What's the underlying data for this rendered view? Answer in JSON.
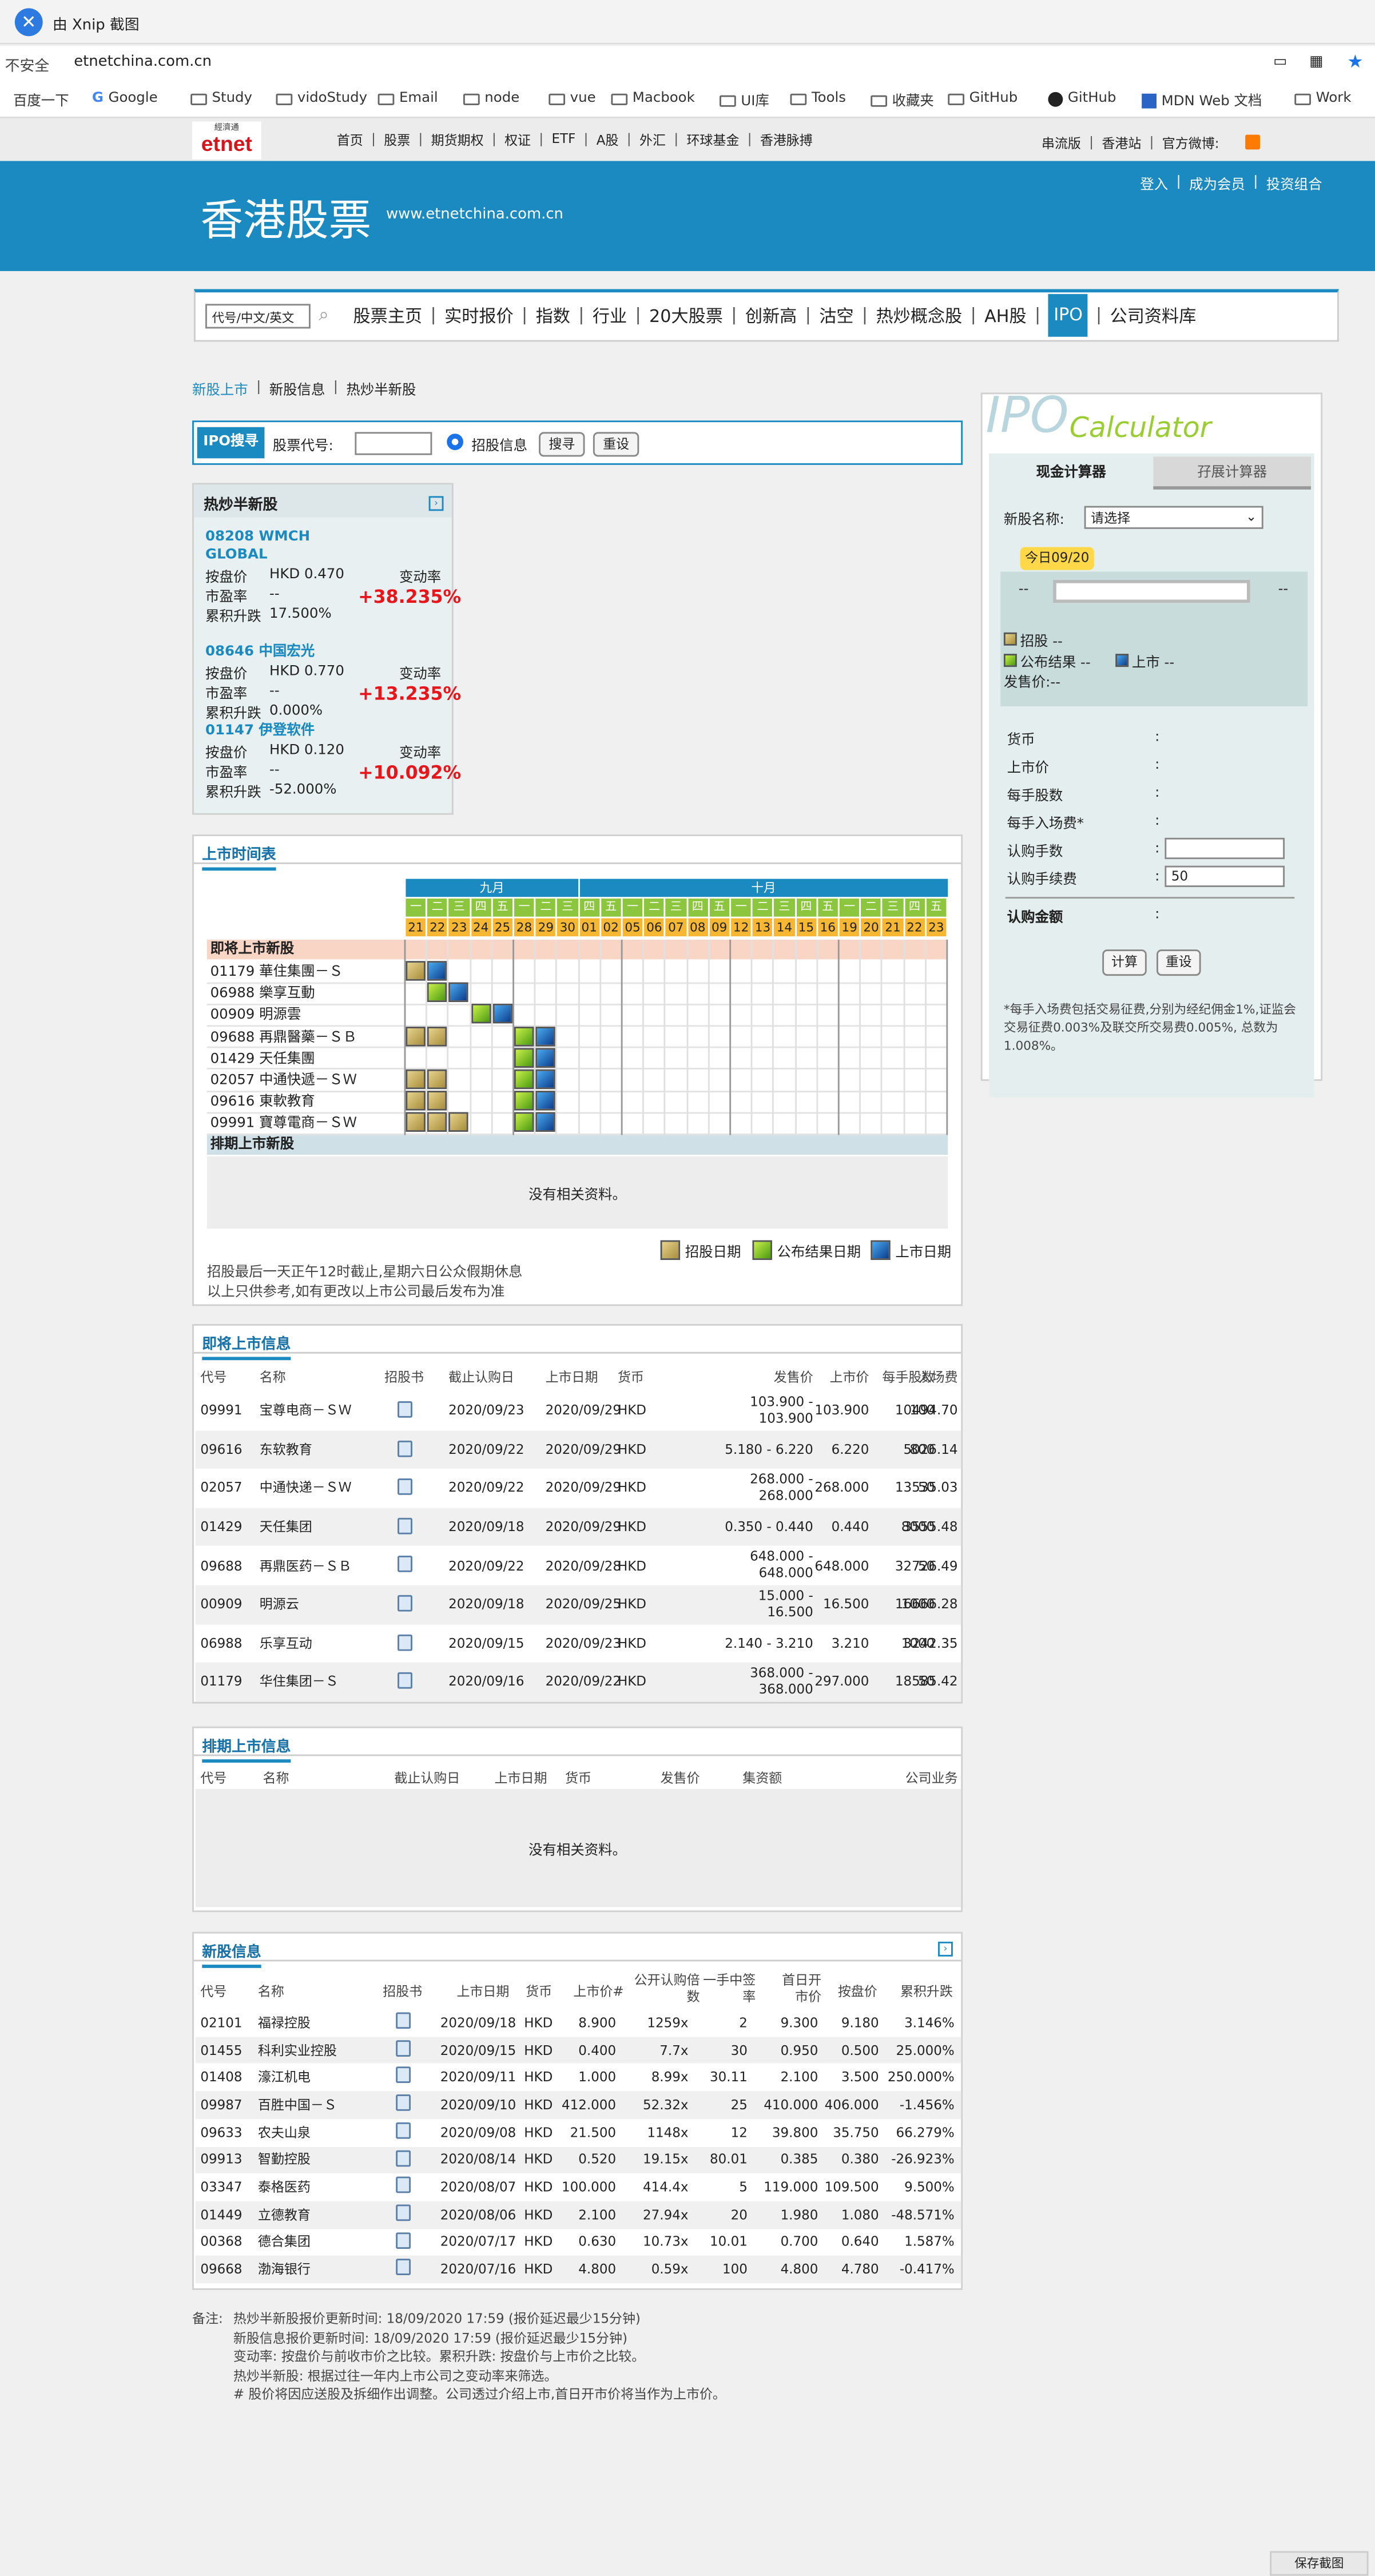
{
  "browser": {
    "title": "由 Xnip 截图",
    "insecure": "不安全",
    "url": "etnetchina.com.cn",
    "bookmarks": [
      "百度一下",
      "Google",
      "Study",
      "vidoStudy",
      "Email",
      "node",
      "vue",
      "Macbook",
      "UI库",
      "Tools",
      "收藏夹",
      "GitHub",
      "GitHub",
      "MDN Web 文档",
      "Work"
    ]
  },
  "site": {
    "logo_top": "經濟通",
    "logo": "etnet",
    "topnav": [
      "首页",
      "股票",
      "期货期权",
      "权证",
      "ETF",
      "A股",
      "外汇",
      "环球基金",
      "香港脉搏"
    ],
    "topright": [
      "串流版",
      "香港站",
      "官方微博:"
    ],
    "banner_title": "香港股票",
    "banner_url": "www.etnetchina.com.cn",
    "user_links": [
      "登入",
      "成为会员",
      "投资组合"
    ],
    "search_placeholder": "代号/中文/英文",
    "mainnav": [
      "股票主页",
      "实时报价",
      "指数",
      "行业",
      "20大股票",
      "创新高",
      "沽空",
      "热炒概念股",
      "AH股",
      "IPO",
      "公司资料库"
    ],
    "subnav": [
      "新股上市",
      "新股信息",
      "热炒半新股"
    ]
  },
  "ipo_search": {
    "tag": "IPO搜寻",
    "code_label": "股票代号:",
    "radio_label": "招股信息",
    "search_btn": "搜寻",
    "reset_btn": "重设"
  },
  "hot_stocks": {
    "title": "热炒半新股",
    "items": [
      {
        "code": "08208",
        "name": "WMCH GLOBAL",
        "close_label": "按盘价",
        "close": "HKD 0.470",
        "pe_label": "市盈率",
        "pe": "--",
        "cum_label": "累积升跌",
        "cum": "17.500%",
        "chg_label": "变动率",
        "chg": "+38.235%"
      },
      {
        "code": "08646",
        "name": "中国宏光",
        "close_label": "按盘价",
        "close": "HKD 0.770",
        "pe_label": "市盈率",
        "pe": "--",
        "cum_label": "累积升跌",
        "cum": "0.000%",
        "chg_label": "变动率",
        "chg": "+13.235%"
      },
      {
        "code": "01147",
        "name": "伊登软件",
        "close_label": "按盘价",
        "close": "HKD 0.120",
        "pe_label": "市盈率",
        "pe": "--",
        "cum_label": "累积升跌",
        "cum": "-52.000%",
        "chg_label": "变动率",
        "chg": "+10.092%"
      }
    ]
  },
  "calculator": {
    "title_ipo": "IPO",
    "title_calc": "Calculator",
    "tab_cash": "现金计算器",
    "tab_margin": "孖展计算器",
    "name_label": "新股名称:",
    "select": "请选择",
    "today": "今日09/20",
    "dash": "--",
    "legend": [
      "招股 --",
      "公布结果 --",
      "上市 --"
    ],
    "price_label": "发售价:--",
    "fields": [
      "货币",
      "上市价",
      "每手股数",
      "每手入场费*",
      "认购手数",
      "认购手续费"
    ],
    "colon": ":",
    "fee_value": "50",
    "total_label": "认购金额",
    "calc_btn": "计算",
    "reset_btn": "重设",
    "note": "*每手入场费包括交易征费,分别为经纪佣金1%,证监会交易征费0.003%及联交所交易费0.005%, 总数为1.008%。"
  },
  "schedule": {
    "title": "上市时间表",
    "month1": "九月",
    "month2": "十月",
    "weekdays": [
      "一",
      "二",
      "三",
      "四",
      "五",
      "一",
      "二",
      "三",
      "四",
      "五",
      "一",
      "二",
      "三",
      "四",
      "五",
      "一",
      "二",
      "三",
      "四",
      "五",
      "一",
      "二",
      "三",
      "四",
      "五"
    ],
    "days": [
      "21",
      "22",
      "23",
      "24",
      "25",
      "28",
      "29",
      "30",
      "01",
      "02",
      "05",
      "06",
      "07",
      "08",
      "09",
      "12",
      "13",
      "14",
      "15",
      "16",
      "19",
      "20",
      "21",
      "22",
      "23"
    ],
    "upcoming_label": "即将上市新股",
    "rows": [
      {
        "label": "01179 華住集團－Ｓ",
        "bars": [
          [
            "y",
            0
          ],
          [
            "b",
            1
          ]
        ]
      },
      {
        "label": "06988 樂享互動",
        "bars": [
          [
            "g",
            1
          ],
          [
            "b",
            2
          ]
        ]
      },
      {
        "label": "00909 明源雲",
        "bars": [
          [
            "g",
            3
          ],
          [
            "b",
            4
          ]
        ]
      },
      {
        "label": "09688 再鼎醫藥－ＳＢ",
        "bars": [
          [
            "y",
            0
          ],
          [
            "y",
            1
          ],
          [
            "g",
            5
          ],
          [
            "b",
            6
          ]
        ]
      },
      {
        "label": "01429 天任集團",
        "bars": [
          [
            "g",
            5
          ],
          [
            "b",
            6
          ]
        ]
      },
      {
        "label": "02057 中通快遞－ＳＷ",
        "bars": [
          [
            "y",
            0
          ],
          [
            "y",
            1
          ],
          [
            "g",
            5
          ],
          [
            "b",
            6
          ]
        ]
      },
      {
        "label": "09616 東軟教育",
        "bars": [
          [
            "y",
            0
          ],
          [
            "y",
            1
          ],
          [
            "g",
            5
          ],
          [
            "b",
            6
          ]
        ]
      },
      {
        "label": "09991 寶尊電商－ＳＷ",
        "bars": [
          [
            "y",
            0
          ],
          [
            "y",
            1
          ],
          [
            "y",
            2
          ],
          [
            "g",
            5
          ],
          [
            "b",
            6
          ]
        ]
      }
    ],
    "scheduled_label": "排期上市新股",
    "no_data": "没有相关资料。",
    "legend": [
      "招股日期",
      "公布结果日期",
      "上市日期"
    ],
    "note1": "招股最后一天正午12时截止,星期六日公众假期休息",
    "note2": "以上只供参考,如有更改以上市公司最后发布为准"
  },
  "upcoming": {
    "title": "即将上市信息",
    "headers": [
      "代号",
      "名称",
      "招股书",
      "截止认购日",
      "上市日期",
      "货币",
      "发售价",
      "上市价",
      "每手股数",
      "入场费"
    ],
    "rows": [
      [
        "09991",
        "宝尊电商－ＳＷ",
        "",
        "2020/09/23",
        "2020/09/29",
        "HKD",
        "103.900 - 103.900",
        "103.900",
        "100",
        "10494.70"
      ],
      [
        "09616",
        "东软教育",
        "",
        "2020/09/22",
        "2020/09/29",
        "HKD",
        "5.180 - 6.220",
        "6.220",
        "800",
        "5026.14"
      ],
      [
        "02057",
        "中通快递－ＳＷ",
        "",
        "2020/09/22",
        "2020/09/29",
        "HKD",
        "268.000 - 268.000",
        "268.000",
        "50",
        "13535.03"
      ],
      [
        "01429",
        "天任集团",
        "",
        "2020/09/18",
        "2020/09/29",
        "HKD",
        "0.350 - 0.440",
        "0.440",
        "8000",
        "3555.48"
      ],
      [
        "09688",
        "再鼎医药－ＳＢ",
        "",
        "2020/09/22",
        "2020/09/28",
        "HKD",
        "648.000 - 648.000",
        "648.000",
        "50",
        "32726.49"
      ],
      [
        "00909",
        "明源云",
        "",
        "2020/09/18",
        "2020/09/25",
        "HKD",
        "15.000 - 16.500",
        "16.500",
        "1000",
        "16666.28"
      ],
      [
        "06988",
        "乐享互动",
        "",
        "2020/09/15",
        "2020/09/23",
        "HKD",
        "2.140 - 3.210",
        "3.210",
        "1000",
        "3242.35"
      ],
      [
        "01179",
        "华住集团－Ｓ",
        "",
        "2020/09/16",
        "2020/09/22",
        "HKD",
        "368.000 - 368.000",
        "297.000",
        "50",
        "18585.42"
      ]
    ]
  },
  "scheduled": {
    "title": "排期上市信息",
    "headers": [
      "代号",
      "名称",
      "截止认购日",
      "上市日期",
      "货币",
      "发售价",
      "集资额",
      "公司业务"
    ],
    "no_data": "没有相关资料。"
  },
  "newinfo": {
    "title": "新股信息",
    "headers": [
      "代号",
      "名称",
      "招股书",
      "上市日期",
      "货币",
      "上市价#",
      "公开认购倍数",
      "一手中签率",
      "首日开市价",
      "按盘价",
      "累积升跌"
    ],
    "rows": [
      [
        "02101",
        "福禄控股",
        "",
        "2020/09/18",
        "HKD",
        "8.900",
        "1259x",
        "2",
        "9.300",
        "9.180",
        "3.146%"
      ],
      [
        "01455",
        "科利实业控股",
        "",
        "2020/09/15",
        "HKD",
        "0.400",
        "7.7x",
        "30",
        "0.950",
        "0.500",
        "25.000%"
      ],
      [
        "01408",
        "濠江机电",
        "",
        "2020/09/11",
        "HKD",
        "1.000",
        "8.99x",
        "30.11",
        "2.100",
        "3.500",
        "250.000%"
      ],
      [
        "09987",
        "百胜中国－Ｓ",
        "",
        "2020/09/10",
        "HKD",
        "412.000",
        "52.32x",
        "25",
        "410.000",
        "406.000",
        "-1.456%"
      ],
      [
        "09633",
        "农夫山泉",
        "",
        "2020/09/08",
        "HKD",
        "21.500",
        "1148x",
        "12",
        "39.800",
        "35.750",
        "66.279%"
      ],
      [
        "09913",
        "智勤控股",
        "",
        "2020/08/14",
        "HKD",
        "0.520",
        "19.15x",
        "80.01",
        "0.385",
        "0.380",
        "-26.923%"
      ],
      [
        "03347",
        "泰格医药",
        "",
        "2020/08/07",
        "HKD",
        "100.000",
        "414.4x",
        "5",
        "119.000",
        "109.500",
        "9.500%"
      ],
      [
        "01449",
        "立德教育",
        "",
        "2020/08/06",
        "HKD",
        "2.100",
        "27.94x",
        "20",
        "1.980",
        "1.080",
        "-48.571%"
      ],
      [
        "00368",
        "德合集团",
        "",
        "2020/07/17",
        "HKD",
        "0.630",
        "10.73x",
        "10.01",
        "0.700",
        "0.640",
        "1.587%"
      ],
      [
        "09668",
        "渤海银行",
        "",
        "2020/07/16",
        "HKD",
        "4.800",
        "0.59x",
        "100",
        "4.800",
        "4.780",
        "-0.417%"
      ]
    ]
  },
  "notes": {
    "label": "备注:",
    "lines": [
      "热炒半新股报价更新时间: 18/09/2020 17:59 (报价延迟最少15分钟)",
      "新股信息报价更新时间: 18/09/2020 17:59 (报价延迟最少15分钟)",
      "变动率: 按盘价与前收市价之比较。累积升跌: 按盘价与上市价之比较。",
      "热炒半新股: 根据过往一年内上市公司之变动率来筛选。",
      "# 股价将因应送股及拆细作出调整。公司透过介绍上市,首日开市价将当作为上市价。"
    ]
  },
  "save_btn": "保存截图"
}
